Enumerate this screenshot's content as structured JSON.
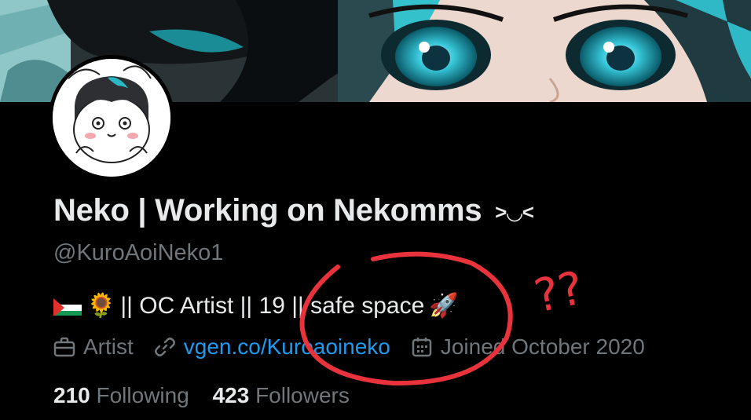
{
  "profile": {
    "display_name": "Neko | Working on Nekomms",
    "name_emoticon": ">◡<",
    "handle": "@KuroAoiNeko1",
    "bio_text": "|| OC Artist || 19 || safe space",
    "bio_flag_icon": "palestine-flag-icon",
    "bio_flower_icon": "sunflower-icon",
    "bio_flower_glyph": "🌻",
    "bio_rocket_glyph": "🚀",
    "category": "Artist",
    "website": "vgen.co/Kuroaoineko",
    "joined": "Joined October 2020"
  },
  "stats": {
    "following_count": "210",
    "following_label": "Following",
    "followers_count": "423",
    "followers_label": "Followers"
  },
  "annotation": {
    "marks": "??",
    "color": "#e8323c"
  },
  "colors": {
    "background": "#000000",
    "text": "#e7e9ea",
    "muted": "#71767b",
    "link": "#1d9bf0",
    "accent_teal": "#2bb8c4"
  }
}
